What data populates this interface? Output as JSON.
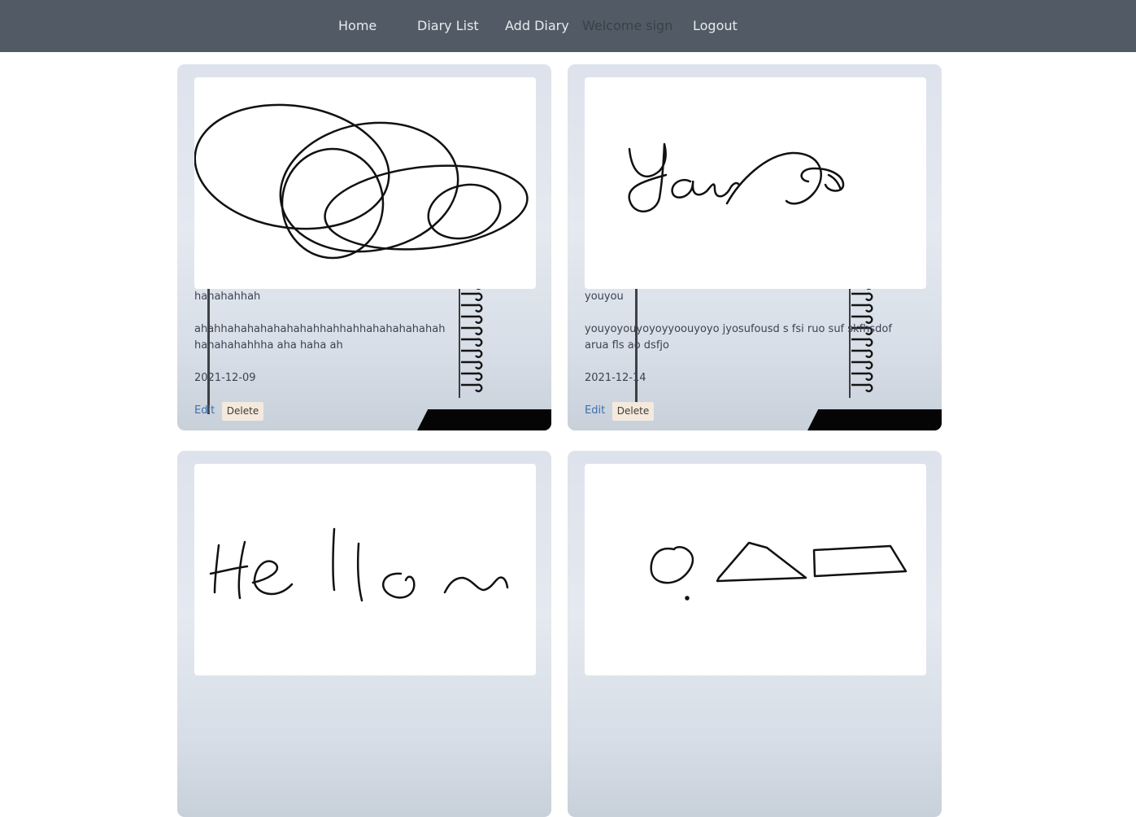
{
  "nav": {
    "home": "Home",
    "diary_list": "Diary List",
    "add_diary": "Add Diary",
    "welcome": "Welcome sign",
    "logout": "Logout"
  },
  "entries": [
    {
      "title": "hahahahhah",
      "body": "ahahhahahahahahahahhahhahhahahahahahah hahahahahhha aha haha ah",
      "date": "2021-12-09",
      "edit_label": "Edit",
      "delete_label": "Delete"
    },
    {
      "title": "youyou",
      "body": "youyoyouyoyoyyoouyoyo jyosufousd s fsi ruo suf skfhsdof arua fls ao dsfjo",
      "date": "2021-12-14",
      "edit_label": "Edit",
      "delete_label": "Delete"
    },
    {},
    {}
  ]
}
